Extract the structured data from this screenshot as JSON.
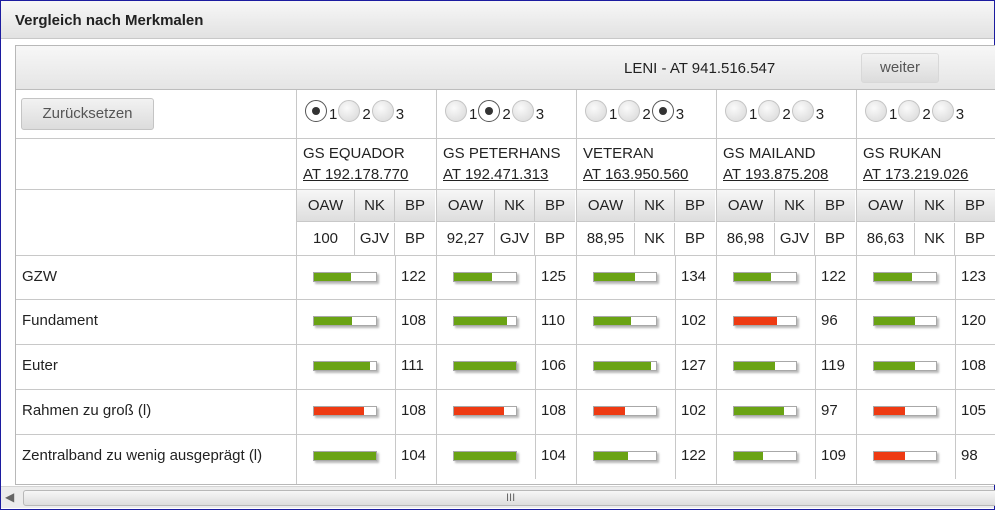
{
  "window": {
    "title": "Vergleich nach Merkmalen"
  },
  "header": {
    "animal": "LENI - AT 941.516.547",
    "next_label": "weiter"
  },
  "reset_label": "Zurücksetzen",
  "radio_labels": [
    "1",
    "2",
    "3"
  ],
  "sub_headers": [
    "OAW",
    "NK",
    "BP"
  ],
  "colors": {
    "green": "#6aa314",
    "red": "#ee3a12",
    "border": "#c8c8c8"
  },
  "bulls": [
    {
      "name": "GS EQUADOR",
      "regno": "AT 192.178.770",
      "selected": 1,
      "oaw": "100",
      "nk": "GJV",
      "bp": "BP",
      "traits": [
        {
          "fill": 0.6,
          "color": "green",
          "value": "122"
        },
        {
          "fill": 0.62,
          "color": "green",
          "value": "108"
        },
        {
          "fill": 0.9,
          "color": "green",
          "value": "111"
        },
        {
          "fill": 0.8,
          "color": "red",
          "value": "108"
        },
        {
          "fill": 1.0,
          "color": "green",
          "value": "104"
        }
      ]
    },
    {
      "name": "GS PETERHANS",
      "regno": "AT 192.471.313",
      "selected": 2,
      "oaw": "92,27",
      "nk": "GJV",
      "bp": "BP",
      "traits": [
        {
          "fill": 0.62,
          "color": "green",
          "value": "125"
        },
        {
          "fill": 0.85,
          "color": "green",
          "value": "110"
        },
        {
          "fill": 1.0,
          "color": "green",
          "value": "106"
        },
        {
          "fill": 0.8,
          "color": "red",
          "value": "108"
        },
        {
          "fill": 1.0,
          "color": "green",
          "value": "104"
        }
      ]
    },
    {
      "name": "VETERAN",
      "regno": "AT 163.950.560",
      "selected": 3,
      "oaw": "88,95",
      "nk": "NK",
      "bp": "BP",
      "traits": [
        {
          "fill": 0.66,
          "color": "green",
          "value": "134"
        },
        {
          "fill": 0.6,
          "color": "green",
          "value": "102"
        },
        {
          "fill": 0.92,
          "color": "green",
          "value": "127"
        },
        {
          "fill": 0.5,
          "color": "red",
          "value": "102"
        },
        {
          "fill": 0.55,
          "color": "green",
          "value": "122"
        }
      ]
    },
    {
      "name": "GS MAILAND",
      "regno": "AT 193.875.208",
      "selected": 0,
      "oaw": "86,98",
      "nk": "GJV",
      "bp": "BP",
      "traits": [
        {
          "fill": 0.6,
          "color": "green",
          "value": "122"
        },
        {
          "fill": 0.7,
          "color": "red",
          "value": "96"
        },
        {
          "fill": 0.66,
          "color": "green",
          "value": "119"
        },
        {
          "fill": 0.8,
          "color": "green",
          "value": "97"
        },
        {
          "fill": 0.46,
          "color": "green",
          "value": "109"
        }
      ]
    },
    {
      "name": "GS RUKAN",
      "regno": "AT 173.219.026",
      "selected": 0,
      "oaw": "86,63",
      "nk": "NK",
      "bp": "BP",
      "traits": [
        {
          "fill": 0.62,
          "color": "green",
          "value": "123"
        },
        {
          "fill": 0.66,
          "color": "green",
          "value": "120"
        },
        {
          "fill": 0.66,
          "color": "green",
          "value": "108"
        },
        {
          "fill": 0.5,
          "color": "red",
          "value": "105"
        },
        {
          "fill": 0.5,
          "color": "red",
          "value": "98"
        }
      ]
    }
  ],
  "trait_labels": [
    "GZW",
    "Fundament",
    "Euter",
    "Rahmen zu groß (l)",
    "Zentralband zu wenig ausgeprägt (l)"
  ],
  "scrollbar": {
    "grip": "III"
  }
}
